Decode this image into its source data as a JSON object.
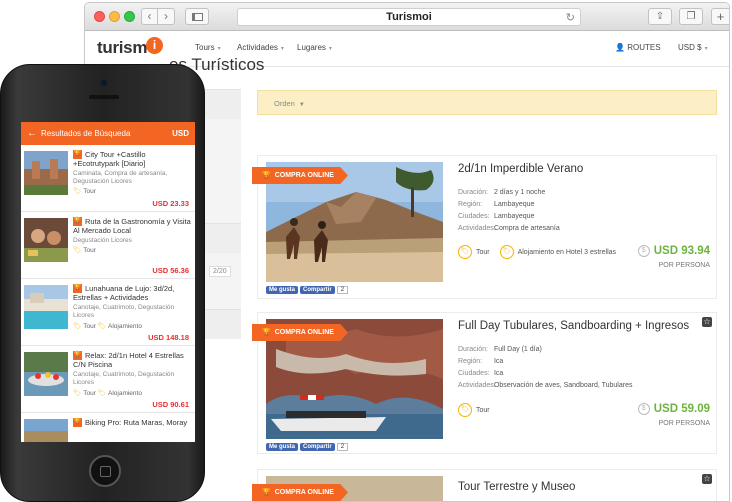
{
  "browser": {
    "url_text": "Turismoi"
  },
  "header": {
    "logo_text": "turismo",
    "logo_badge": "i",
    "nav": [
      {
        "label": "Tours"
      },
      {
        "label": "Actividades"
      },
      {
        "label": "Lugares"
      }
    ],
    "routes_label": "ROUTES",
    "currency_label": "USD $"
  },
  "page": {
    "title": "es Turísticos",
    "order_label": "Orden",
    "pager_text": "2/20"
  },
  "cards": [
    {
      "ribbon": "COMPRA ONLINE",
      "title": "2d/1n Imperdible Verano",
      "meta": [
        {
          "k": "Duración:",
          "v": "2 días y 1 noche"
        },
        {
          "k": "Región:",
          "v": "Lambayeque"
        },
        {
          "k": "Ciudades:",
          "v": "Lambayeque"
        },
        {
          "k": "Actividades:",
          "v": "Compra de artesanía"
        }
      ],
      "tags": [
        "Tour",
        "Alojamiento en Hotel 3 estrellas"
      ],
      "price": "USD 93.94",
      "per_person": "POR PERSONA",
      "fb_like": "Me gusta",
      "fb_share": "Compartir",
      "fb_count": "2"
    },
    {
      "ribbon": "COMPRA ONLINE",
      "title": "Full Day Tubulares, Sandboarding + Ingresos",
      "meta": [
        {
          "k": "Duración:",
          "v": "Full Day (1 día)"
        },
        {
          "k": "Región:",
          "v": "Ica"
        },
        {
          "k": "Ciudades:",
          "v": "Ica"
        },
        {
          "k": "Actividades:",
          "v": "Observación de aves, Sandboard, Tubulares"
        }
      ],
      "tags": [
        "Tour"
      ],
      "price": "USD 59.09",
      "per_person": "POR PERSONA",
      "fb_like": "Me gusta",
      "fb_share": "Compartir",
      "fb_count": "2"
    },
    {
      "ribbon": "COMPRA ONLINE",
      "title": "Tour Terrestre y Museo"
    }
  ],
  "mobile": {
    "header_title": "Resultados de Búsqueda",
    "currency": "USD",
    "items": [
      {
        "title": "City Tour +Castillo +Ecotrutypark [Diario]",
        "sub": "Caminata, Compra de artesanía, Degustación Licores",
        "tags": [
          "Tour"
        ],
        "price": "USD 23.33"
      },
      {
        "title": "Ruta de la Gastronomía y Visita Al Mercado Local",
        "sub": "Degustación Licores",
        "tags": [
          "Tour"
        ],
        "price": "USD 56.36"
      },
      {
        "title": "Lunahuana de Lujo: 3d/2d, Estrellas + Actividades",
        "sub": "Canotaje, Cuatrimoto, Degustación Licores",
        "tags": [
          "Tour",
          "Alojamiento"
        ],
        "price": "USD 148.18"
      },
      {
        "title": "Relax: 2d/1n Hotel 4 Estrellas C/N Piscina",
        "sub": "Canotaje, Cuatrimoto, Degustación Licores",
        "tags": [
          "Tour",
          "Alojamiento"
        ],
        "price": "USD 90.61"
      },
      {
        "title": "Biking Pro: Ruta Maras, Moray",
        "sub": "",
        "tags": [],
        "price": ""
      }
    ]
  },
  "colors": {
    "brand_orange": "#f26522",
    "price_green": "#6cb33f",
    "price_red": "#e8312f",
    "tag_yellow": "#f5b400",
    "order_bar": "#fcefc5"
  }
}
